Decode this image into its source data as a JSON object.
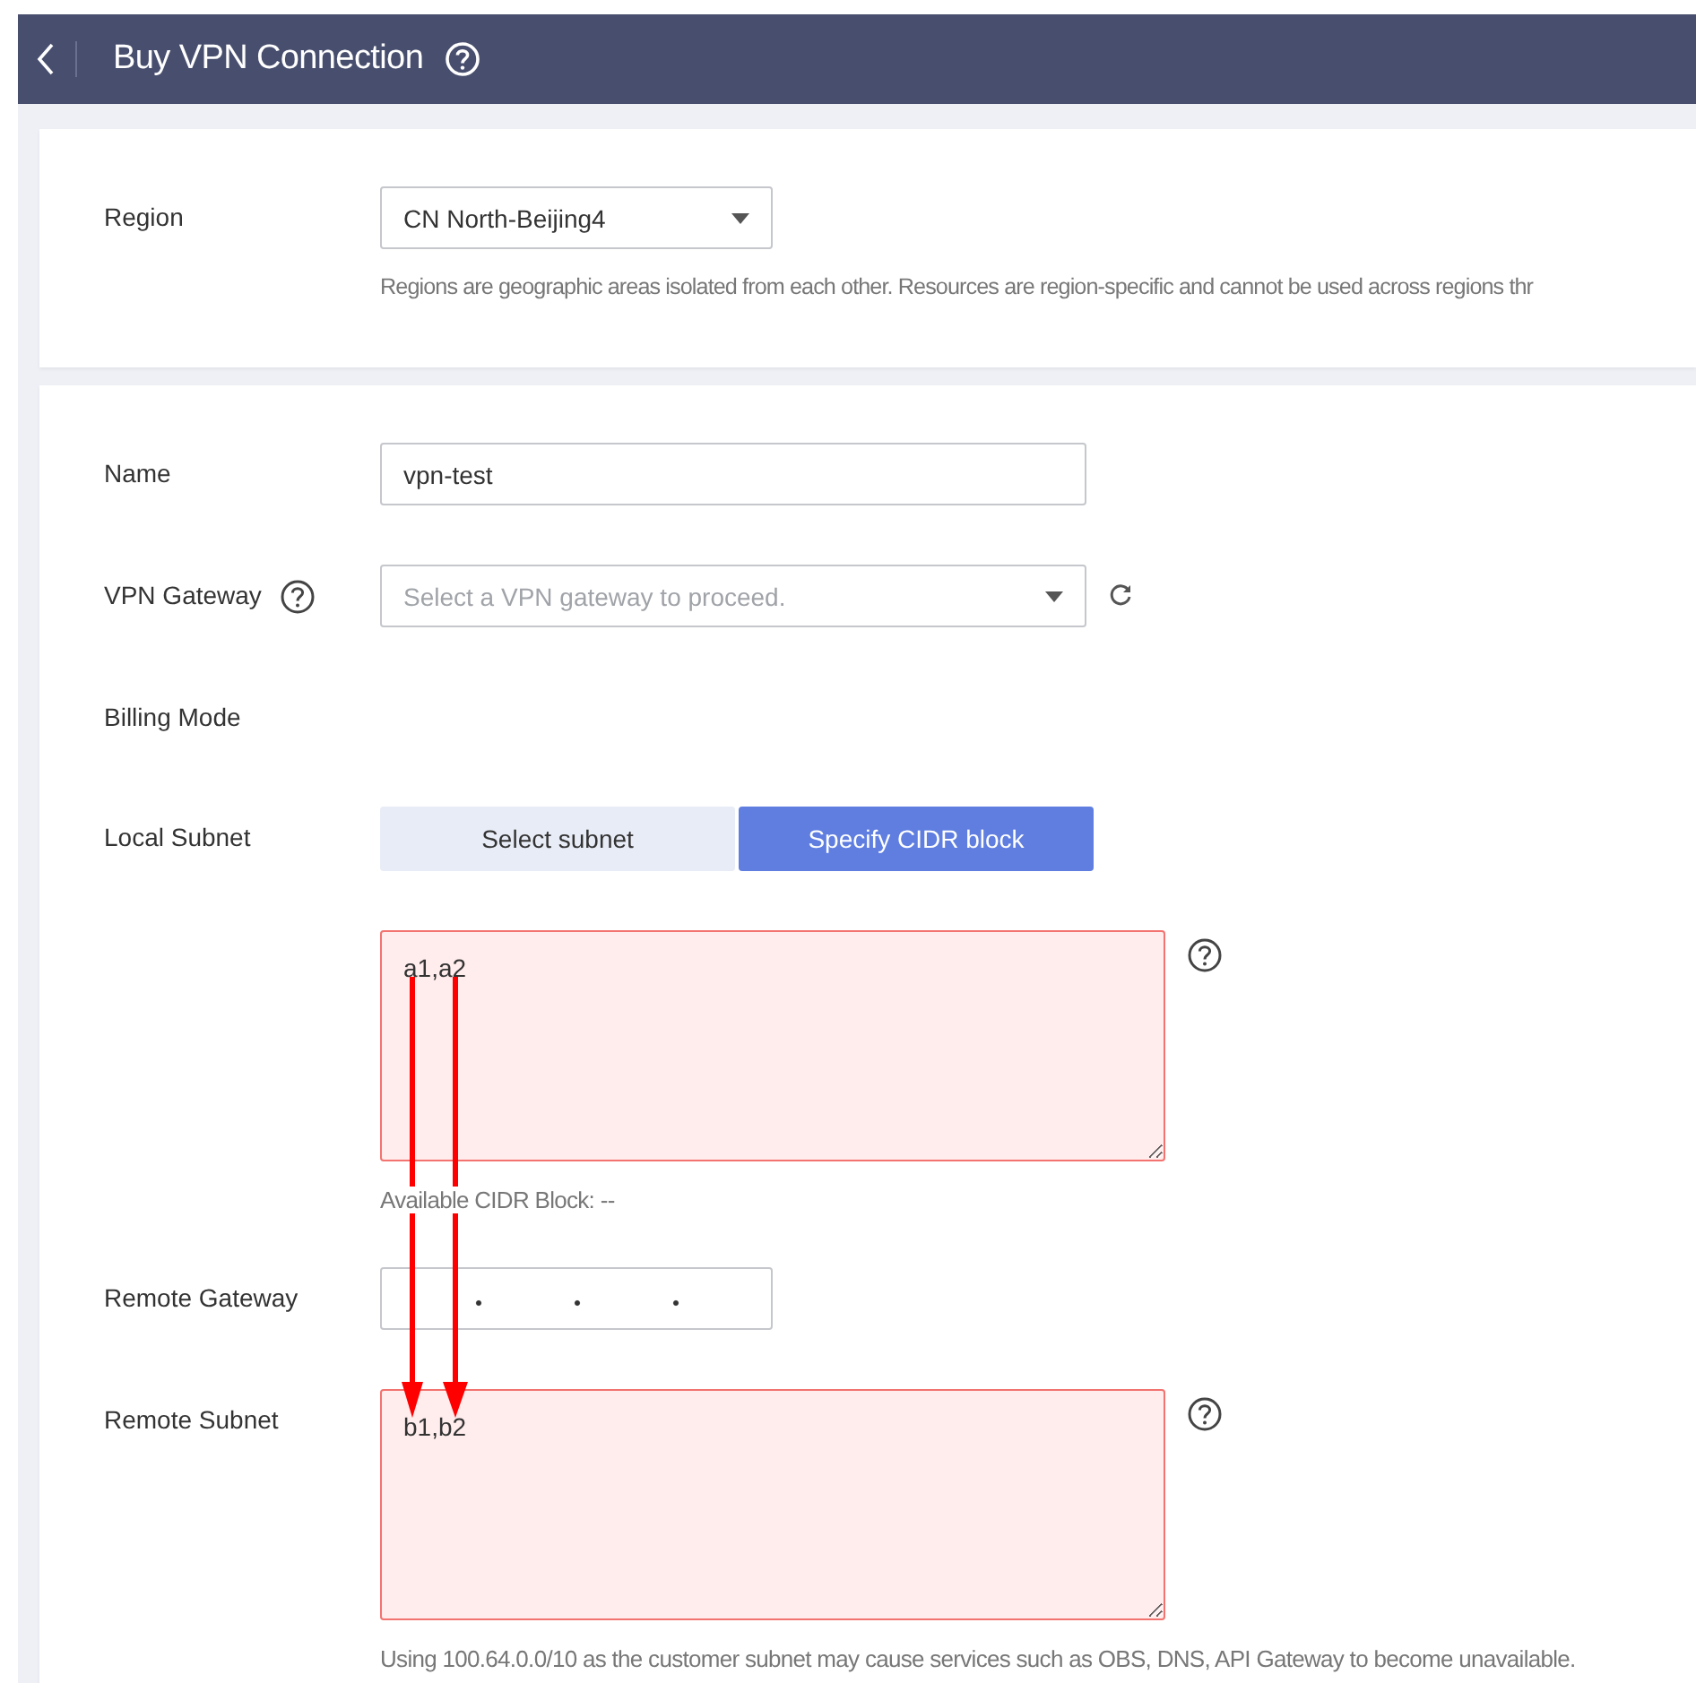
{
  "header": {
    "title": "Buy VPN Connection"
  },
  "region": {
    "label": "Region",
    "value": "CN North-Beijing4",
    "hint": "Regions are geographic areas isolated from each other. Resources are region-specific and cannot be used across regions thr"
  },
  "fields": [
    {
      "kind": "text",
      "label": "Name",
      "value": "vpn-test"
    },
    {
      "kind": "select",
      "label": "VPN Gateway",
      "placeholder": "Select a VPN gateway to proceed."
    },
    {
      "kind": "empty",
      "label": "Billing Mode"
    },
    {
      "kind": "segmented",
      "label": "Local Subnet",
      "options": [
        {
          "label": "Select subnet",
          "selected": false
        },
        {
          "label": "Specify CIDR block",
          "selected": true
        }
      ]
    },
    {
      "kind": "textarea",
      "value": "a1,a2",
      "error": true,
      "hint": "Available CIDR Block: --"
    },
    {
      "kind": "ip",
      "label": "Remote Gateway"
    },
    {
      "kind": "textarea",
      "label": "Remote Subnet",
      "value": "b1,b2",
      "error": true,
      "hint": "Using 100.64.0.0/10 as the customer subnet may cause services such as OBS, DNS, API Gateway to become unavailable."
    }
  ]
}
